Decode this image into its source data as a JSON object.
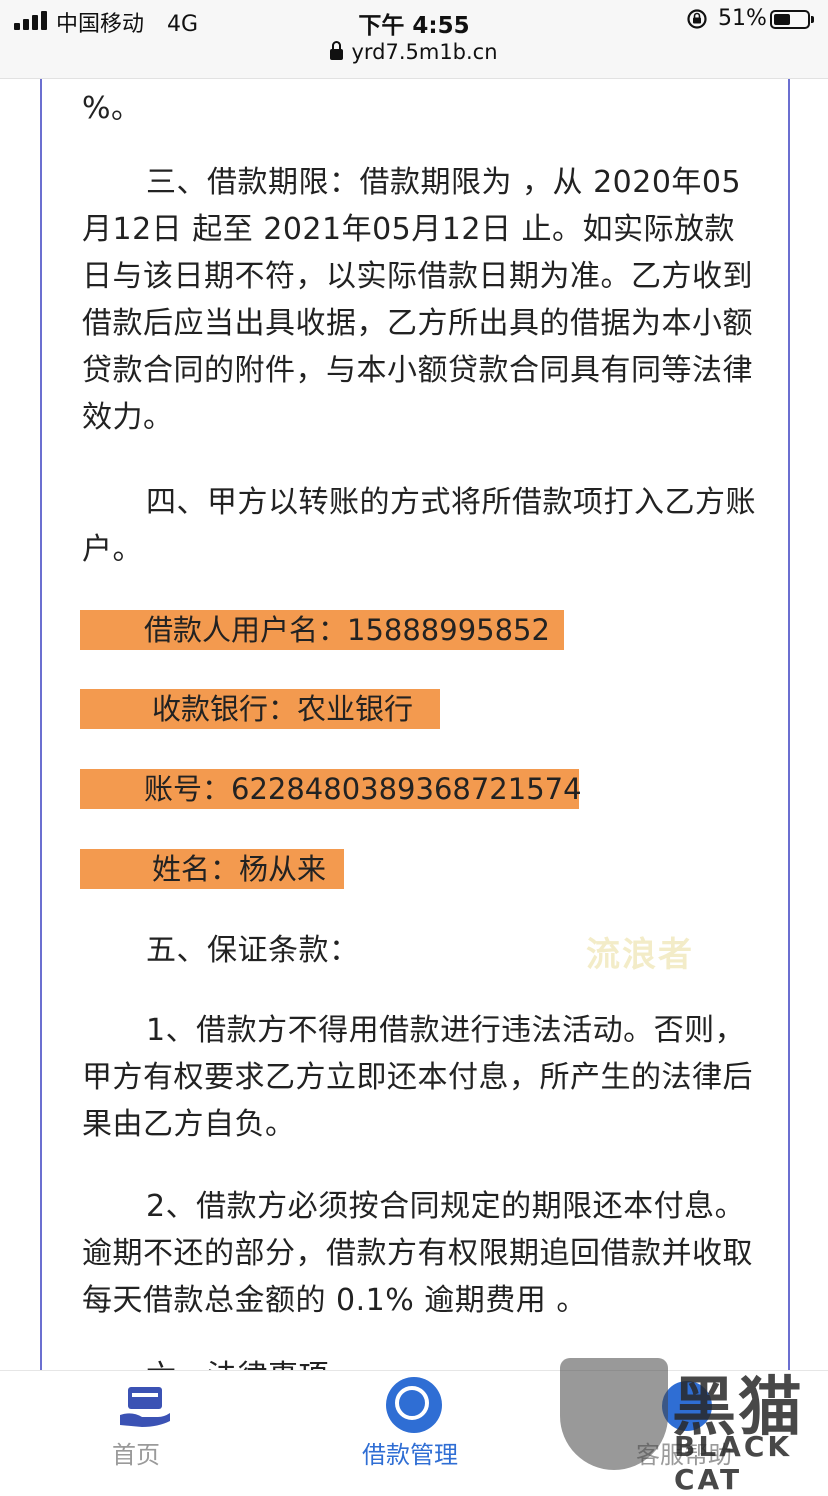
{
  "status_bar": {
    "carrier": "中国移动",
    "network": "4G",
    "time": "下午 4:55",
    "url": "yrd7.5m1b.cn",
    "battery_percent": "51%",
    "battery_level": 0.51
  },
  "contract": {
    "fragment": "%。",
    "clause3": "三、借款期限：借款期限为 ，从 2020年05月12日 起至  2021年05月12日 止。如实际放款日与该日期不符，以实际借款日期为准。乙方收到借款后应当出具收据，乙方所出具的借据为本小额贷款合同的附件，与本小额贷款合同具有同等法律效力。",
    "clause4": "四、甲方以转账的方式将所借款项打入乙方账户。",
    "borrower_username": "借款人用户名：15888995852",
    "receiving_bank": "收款银行：农业银行",
    "account_number": "账号：6228480389368721574",
    "account_name": "姓名：杨从来",
    "clause5_title": "五、保证条款：",
    "clause5_item1": "1、借款方不得用借款进行违法活动。否则，甲方有权要求乙方立即还本付息，所产生的法律后果由乙方自负。",
    "clause5_item2": "2、借款方必须按合同规定的期限还本付息。逾期不还的部分，借款方有权限期追回借款并收取每天借款总金额的 0.1% 逾期费用 。",
    "clause6_partial": "六、法律事项"
  },
  "watermark_text": "流浪者",
  "tab_bar": {
    "tabs": [
      {
        "label": "首页",
        "icon": "home-card-icon",
        "active": false
      },
      {
        "label": "借款管理",
        "icon": "loan-manage-icon",
        "active": true
      },
      {
        "label": "客服帮助",
        "icon": "customer-service-icon",
        "active": false
      }
    ]
  },
  "overlay_logo": {
    "text": "黑猫",
    "subtext": "BLACK CAT"
  },
  "colors": {
    "highlight": "#f39a4f",
    "accent": "#2f6ed4",
    "border": "#6b6fd0"
  }
}
